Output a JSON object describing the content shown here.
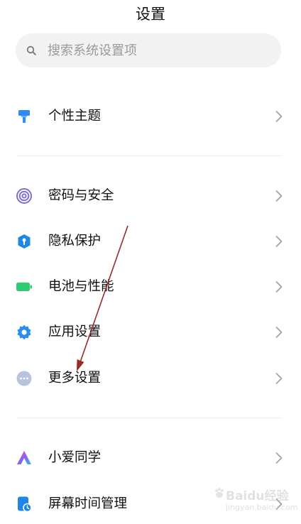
{
  "header": {
    "title": "设置"
  },
  "search": {
    "placeholder": "搜索系统设置项"
  },
  "colors": {
    "personalization": "#2f8af5",
    "password": "#7b6fd6",
    "privacy": "#1e88e5",
    "battery": "#2ecc71",
    "apps": "#2a8bf2",
    "more": "#b8c3e0",
    "annotation_arrow": "#9a2a2a"
  },
  "sections": [
    {
      "items": [
        {
          "label": "个性主题",
          "icon": "paint-roller-icon"
        }
      ]
    },
    {
      "items": [
        {
          "label": "密码与安全",
          "icon": "fingerprint-target-icon"
        },
        {
          "label": "隐私保护",
          "icon": "shield-icon"
        },
        {
          "label": "电池与性能",
          "icon": "battery-icon"
        },
        {
          "label": "应用设置",
          "icon": "gear-icon"
        },
        {
          "label": "更多设置",
          "icon": "more-dots-icon"
        }
      ]
    },
    {
      "items": [
        {
          "label": "小爱同学",
          "icon": "xiaoai-icon"
        },
        {
          "label": "屏幕时间管理",
          "icon": "screen-time-icon"
        }
      ]
    }
  ],
  "watermark": {
    "text": "Baidu经验",
    "sub": "jingyan.baidu.com"
  }
}
